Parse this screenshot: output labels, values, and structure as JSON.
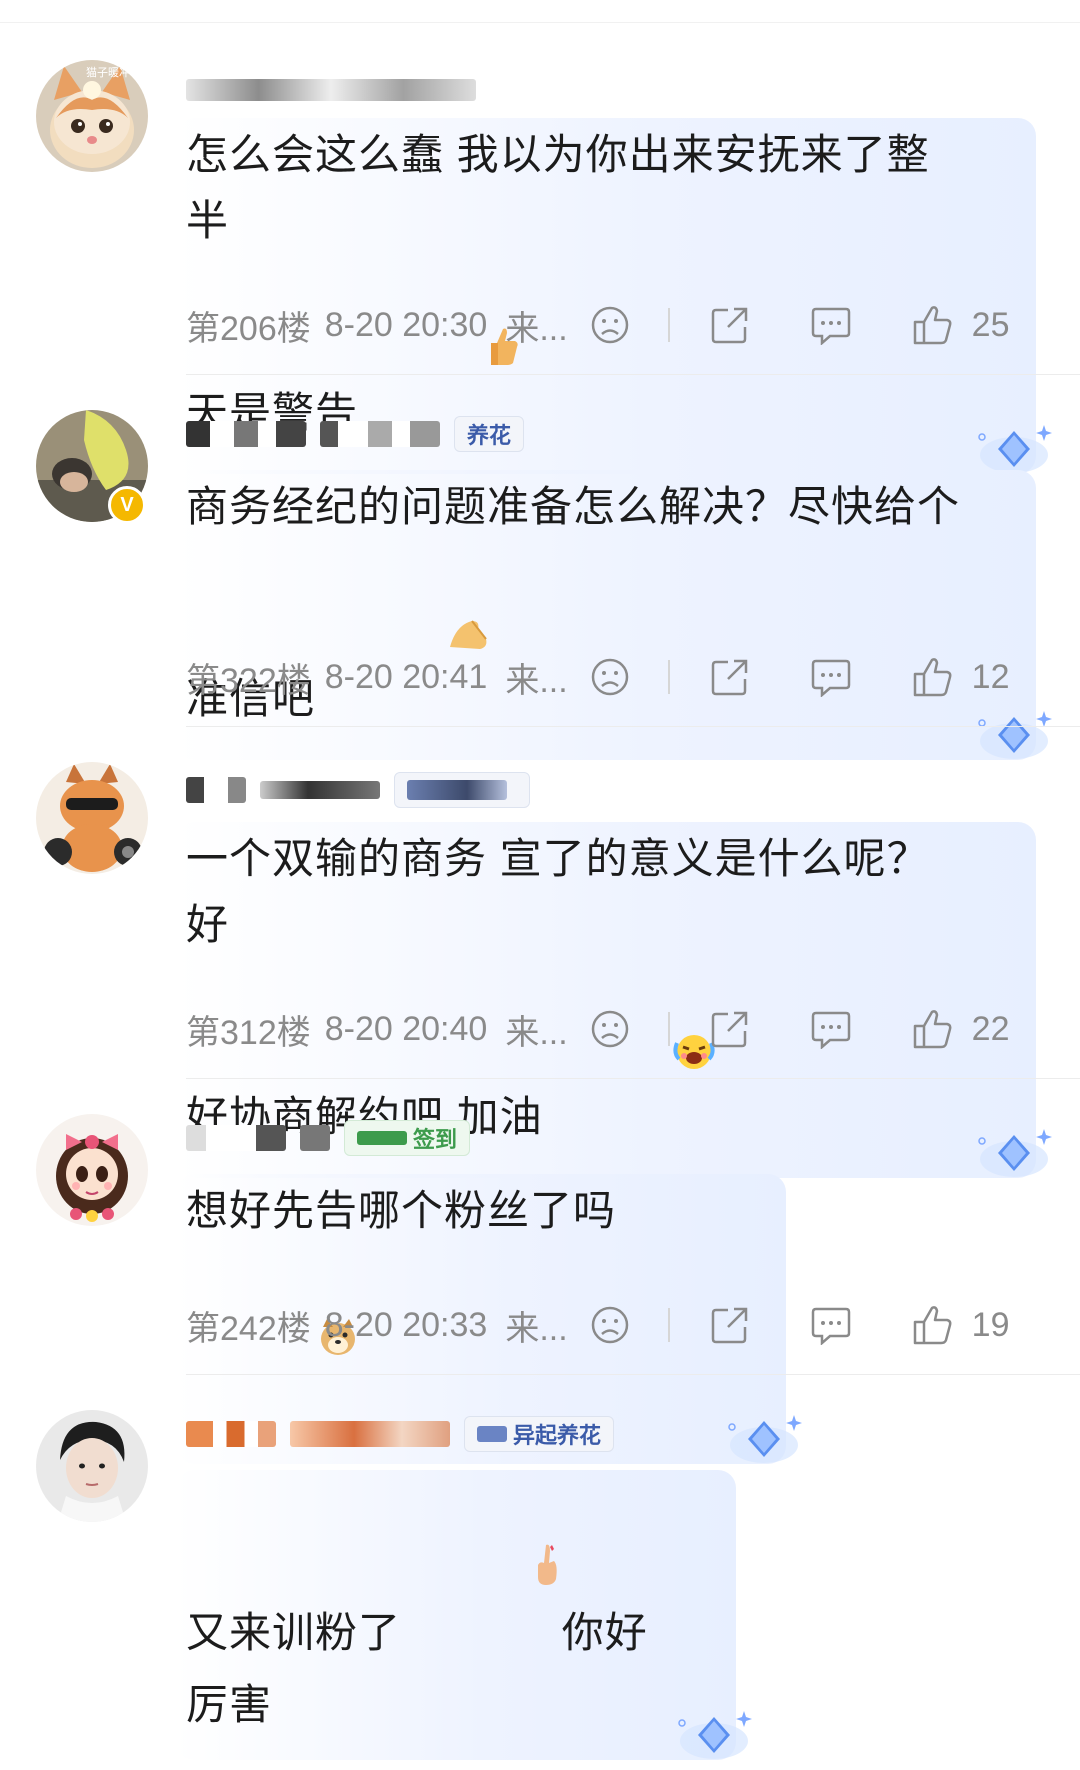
{
  "comments": [
    {
      "text": "怎么会这么蠢 我以为你出来安抚来了整半\n天是警告",
      "emoji": "thumbs-up-emoji",
      "floor": "第206楼",
      "time": "8-20 20:30",
      "source": "来...",
      "likes": "25",
      "avatar": "kitten-avatar",
      "avatar_caption": "猫子暖冲",
      "badge": null
    },
    {
      "text": "商务经纪的问题准备怎么解决？尽快给个\n准信吧",
      "emoji": "pinch-hand-emoji",
      "floor": "第322楼",
      "time": "8-20 20:41",
      "source": "来...",
      "likes": "12",
      "avatar": "person-avatar",
      "verified": true,
      "badge": "养花"
    },
    {
      "text": "一个双输的商务 宣了的意义是什么呢？好\n好协商解约吧 加油",
      "emoji": "crying-laughing-emoji",
      "floor": "第312楼",
      "time": "8-20 20:40",
      "source": "来...",
      "likes": "22",
      "avatar": "cat-sunglasses-avatar",
      "badge": ""
    },
    {
      "text": "想好先告哪个粉丝了吗",
      "emoji": "doge-emoji",
      "floor": "第242楼",
      "time": "8-20 20:33",
      "source": "来...",
      "likes": "19",
      "avatar": "cartoon-girl-avatar",
      "badge": "签到"
    },
    {
      "text": "又来训粉了",
      "text_after": "你好厉害",
      "emoji": "finger-heart-emoji",
      "avatar": "man-avatar",
      "badge": "异起养花"
    }
  ],
  "colors": {
    "meta": "#8a8a8a",
    "badge_blue": "#3b5ba9",
    "badge_green": "#3d9b4c",
    "verified": "#f5b800"
  }
}
